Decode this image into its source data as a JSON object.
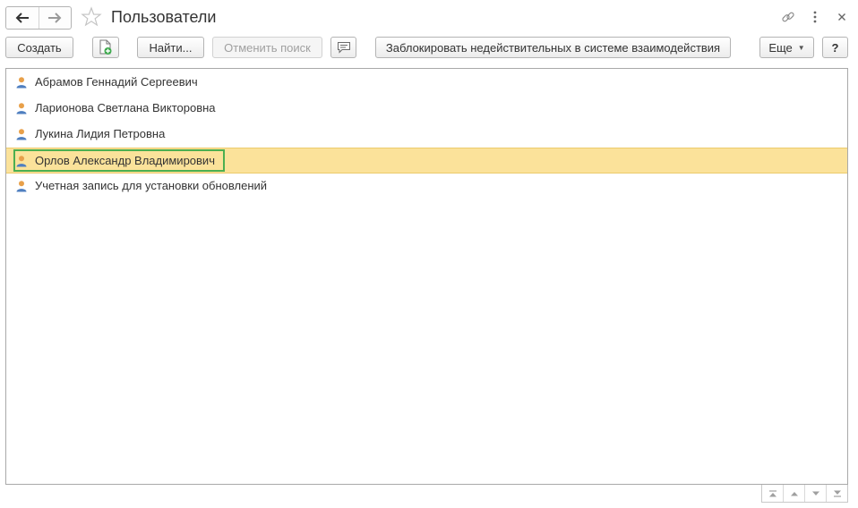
{
  "window": {
    "title": "Пользователи"
  },
  "titlebar": {
    "back_icon": "arrow-left-icon",
    "forward_icon": "arrow-right-icon",
    "favorite_icon": "star-icon",
    "link_icon": "link-icon",
    "menu_icon": "more-vertical-icon",
    "close_icon": "close-icon"
  },
  "toolbar": {
    "create_label": "Создать",
    "copy_icon": "add-document-icon",
    "find_label": "Найти...",
    "cancel_search_label": "Отменить поиск",
    "comment_icon": "speech-bubble-icon",
    "block_label": "Заблокировать недействительных в системе взаимодействия",
    "more_label": "Еще",
    "help_label": "?"
  },
  "users": [
    {
      "name": "Абрамов Геннадий Сергеевич",
      "selected": false
    },
    {
      "name": "Ларионова Светлана Викторовна",
      "selected": false
    },
    {
      "name": "Лукина Лидия Петровна",
      "selected": false
    },
    {
      "name": "Орлов Александр Владимирович",
      "selected": true
    },
    {
      "name": "Учетная запись для установки обновлений",
      "selected": false
    }
  ],
  "scroll": {
    "icons": [
      "scroll-top-icon",
      "scroll-up-icon",
      "scroll-down-icon",
      "scroll-bottom-icon"
    ]
  },
  "colors": {
    "selection": "#fbe29a",
    "focus_border": "#4caf50",
    "user_icon": "#e8a04a"
  }
}
